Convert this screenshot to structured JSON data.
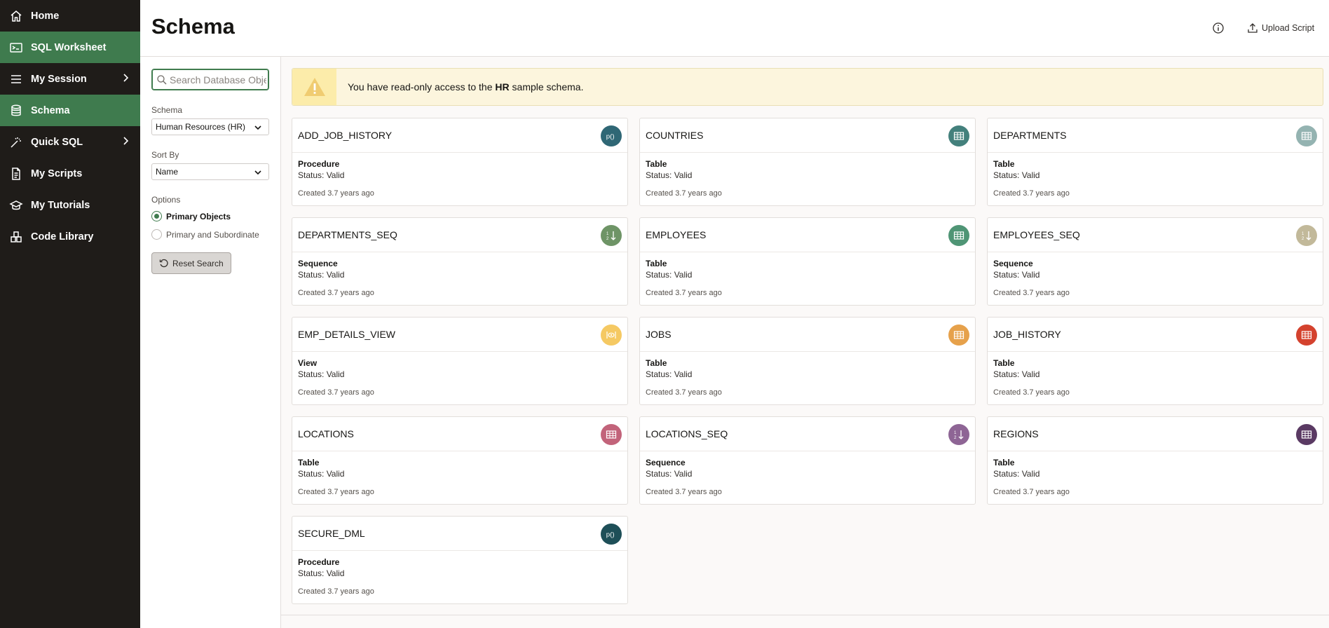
{
  "nav": {
    "items": [
      {
        "label": "Home",
        "icon": "home-icon"
      },
      {
        "label": "SQL Worksheet",
        "icon": "terminal-icon"
      },
      {
        "label": "My Session",
        "icon": "menu-icon"
      },
      {
        "label": "Schema",
        "icon": "database-icon"
      },
      {
        "label": "Quick SQL",
        "icon": "magic-wand-icon"
      },
      {
        "label": "My Scripts",
        "icon": "document-icon"
      },
      {
        "label": "My Tutorials",
        "icon": "graduation-cap-icon"
      },
      {
        "label": "Code Library",
        "icon": "blocks-icon"
      }
    ],
    "active": [
      "SQL Worksheet",
      "Schema"
    ]
  },
  "header": {
    "title": "Schema",
    "upload_label": "Upload Script"
  },
  "filters": {
    "search_placeholder": "Search Database Objects",
    "schema_label": "Schema",
    "schema_value": "Human Resources (HR)",
    "sort_label": "Sort By",
    "sort_value": "Name",
    "options_label": "Options",
    "option_primary": "Primary Objects",
    "option_subordinate": "Primary and Subordinate",
    "selected_option": "Primary Objects",
    "reset_label": "Reset Search"
  },
  "alert": {
    "prefix": "You have read-only access to the ",
    "schema": "HR",
    "suffix": " sample schema."
  },
  "colors": {
    "accent": "#3f7b4e",
    "nav_bg": "#1f1c19",
    "alert_bg": "#fcf5dd",
    "alert_icon": "#f0cc71"
  },
  "cards": [
    {
      "name": "ADD_JOB_HISTORY",
      "type": "Procedure",
      "status": "Status: Valid",
      "created": "Created 3.7 years ago",
      "icon": "procedure-icon",
      "color": "#2f6775"
    },
    {
      "name": "COUNTRIES",
      "type": "Table",
      "status": "Status: Valid",
      "created": "Created 3.7 years ago",
      "icon": "table-icon",
      "color": "#43807c"
    },
    {
      "name": "DEPARTMENTS",
      "type": "Table",
      "status": "Status: Valid",
      "created": "Created 3.7 years ago",
      "icon": "table-icon",
      "color": "#94b3b1"
    },
    {
      "name": "DEPARTMENTS_SEQ",
      "type": "Sequence",
      "status": "Status: Valid",
      "created": "Created 3.7 years ago",
      "icon": "sequence-icon",
      "color": "#6e9466"
    },
    {
      "name": "EMPLOYEES",
      "type": "Table",
      "status": "Status: Valid",
      "created": "Created 3.7 years ago",
      "icon": "table-icon",
      "color": "#4f9575"
    },
    {
      "name": "EMPLOYEES_SEQ",
      "type": "Sequence",
      "status": "Status: Valid",
      "created": "Created 3.7 years ago",
      "icon": "sequence-icon",
      "color": "#c2b99a"
    },
    {
      "name": "EMP_DETAILS_VIEW",
      "type": "View",
      "status": "Status: Valid",
      "created": "Created 3.7 years ago",
      "icon": "view-icon",
      "color": "#f5c963"
    },
    {
      "name": "JOBS",
      "type": "Table",
      "status": "Status: Valid",
      "created": "Created 3.7 years ago",
      "icon": "table-icon",
      "color": "#e6a14b"
    },
    {
      "name": "JOB_HISTORY",
      "type": "Table",
      "status": "Status: Valid",
      "created": "Created 3.7 years ago",
      "icon": "table-icon",
      "color": "#d4422e"
    },
    {
      "name": "LOCATIONS",
      "type": "Table",
      "status": "Status: Valid",
      "created": "Created 3.7 years ago",
      "icon": "table-icon",
      "color": "#c2637a"
    },
    {
      "name": "LOCATIONS_SEQ",
      "type": "Sequence",
      "status": "Status: Valid",
      "created": "Created 3.7 years ago",
      "icon": "sequence-icon",
      "color": "#8e6595"
    },
    {
      "name": "REGIONS",
      "type": "Table",
      "status": "Status: Valid",
      "created": "Created 3.7 years ago",
      "icon": "table-icon",
      "color": "#5a3a63"
    },
    {
      "name": "SECURE_DML",
      "type": "Procedure",
      "status": "Status: Valid",
      "created": "Created 3.7 years ago",
      "icon": "procedure-icon",
      "color": "#1e4f58"
    }
  ]
}
